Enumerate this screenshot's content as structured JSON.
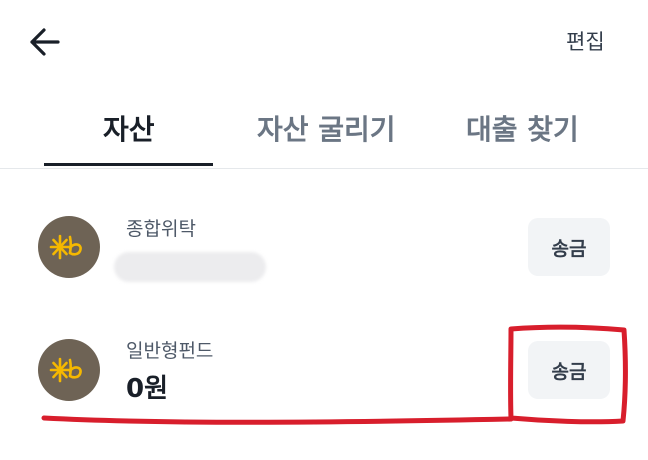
{
  "header": {
    "edit_label": "편집"
  },
  "tabs": [
    {
      "label": "자산",
      "active": true
    },
    {
      "label": "자산 굴리기",
      "active": false
    },
    {
      "label": "대출 찾기",
      "active": false
    }
  ],
  "accounts": [
    {
      "name": "종합위탁",
      "balance": null,
      "balance_hidden": true,
      "button_label": "송금",
      "icon": "kb-logo-icon"
    },
    {
      "name": "일반형펀드",
      "balance": "0원",
      "balance_hidden": false,
      "button_label": "송금",
      "icon": "kb-logo-icon"
    }
  ],
  "colors": {
    "accent": "#191f28",
    "logo_bg": "#6e6355",
    "logo_star": "#f5b800",
    "annotation": "#d81e2c",
    "button_bg": "#f2f4f6"
  }
}
